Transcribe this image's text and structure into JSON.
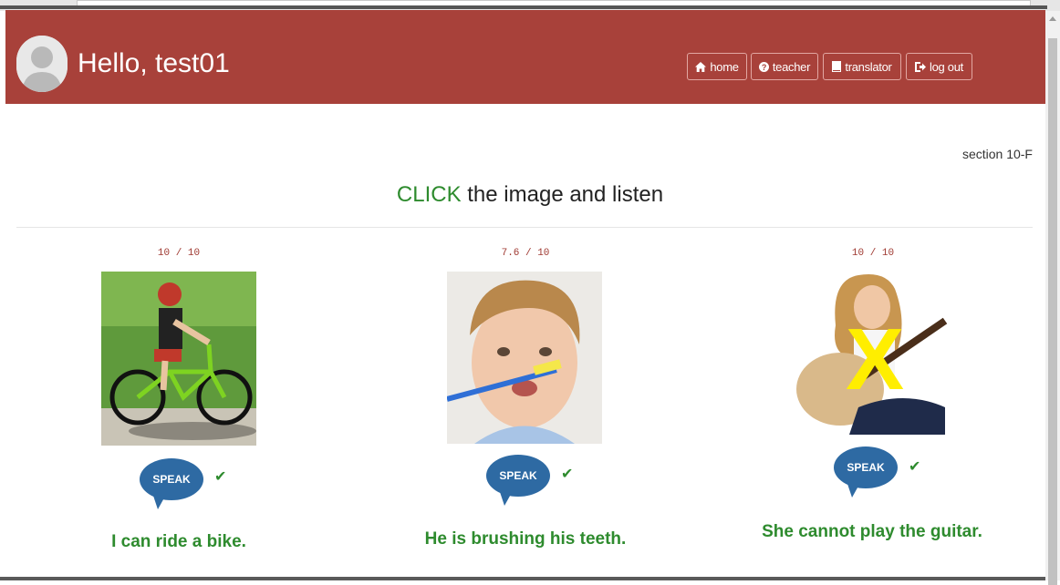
{
  "header": {
    "greeting": "Hello, test01",
    "nav": [
      {
        "label": "home",
        "icon": "home-icon"
      },
      {
        "label": "teacher",
        "icon": "question-icon"
      },
      {
        "label": "translator",
        "icon": "book-icon"
      },
      {
        "label": "log out",
        "icon": "logout-icon"
      }
    ]
  },
  "main": {
    "section_label": "section 10-F",
    "heading_action": "CLICK",
    "heading_rest": " the image and listen"
  },
  "cards": [
    {
      "score": "10 / 10",
      "speak_label": "SPEAK",
      "check": "✔",
      "sentence": "I can ride a bike."
    },
    {
      "score": "7.6 / 10",
      "speak_label": "SPEAK",
      "check": "✔",
      "sentence": "He is brushing his teeth."
    },
    {
      "score": "10 / 10",
      "speak_label": "SPEAK",
      "check": "✔",
      "sentence": "She cannot play the guitar.",
      "overlay_mark": "X"
    }
  ],
  "colors": {
    "header_bg": "#a8413a",
    "accent_green": "#2e8b2e",
    "speak_blue": "#2e6aa3",
    "score_red": "#a03a32",
    "overlay_yellow": "#ffee00"
  }
}
